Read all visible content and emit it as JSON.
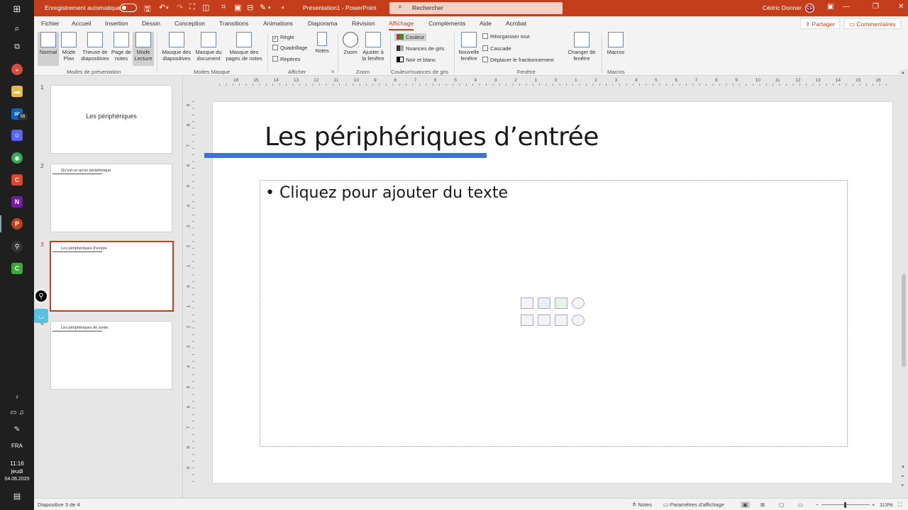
{
  "titlebar": {
    "autosave_label": "Enregistrement automatique",
    "doc_title": "Présentation1 - PowerPoint",
    "search_placeholder": "Rechercher",
    "user_name": "Cédric Donner",
    "user_initials": "CD"
  },
  "tabs": [
    "Fichier",
    "Accueil",
    "Insertion",
    "Dessin",
    "Conception",
    "Transitions",
    "Animations",
    "Diaporama",
    "Révision",
    "Affichage",
    "Compléments",
    "Aide",
    "Acrobat"
  ],
  "active_tab": "Affichage",
  "share_label": "Partager",
  "comments_label": "Commentaires",
  "ribbon": {
    "modes_presentation": {
      "group_label": "Modes de présentation",
      "buttons": [
        "Normal",
        "Mode Plan",
        "Trieuse de diapositives",
        "Page de notes",
        "Mode Lecture"
      ]
    },
    "modes_masque": {
      "group_label": "Modes Masque",
      "buttons": [
        "Masque des diapositives",
        "Masque du document",
        "Masque des pages de notes"
      ]
    },
    "afficher": {
      "group_label": "Afficher",
      "checks": [
        {
          "label": "Règle",
          "checked": true
        },
        {
          "label": "Quadrillage",
          "checked": false
        },
        {
          "label": "Repères",
          "checked": false
        }
      ],
      "notes_label": "Notes"
    },
    "zoom": {
      "group_label": "Zoom",
      "buttons": [
        "Zoom",
        "Ajuster à la fenêtre"
      ]
    },
    "couleur": {
      "group_label": "Couleur/nuances de gris",
      "options": [
        "Couleur",
        "Nuances de gris",
        "Noir et blanc"
      ]
    },
    "fenetre": {
      "group_label": "Fenêtre",
      "new_window": "Nouvelle fenêtre",
      "options": [
        "Réorganiser tout",
        "Cascade",
        "Déplacer le fractionnement"
      ],
      "switch": "Changer de fenêtre"
    },
    "macros": {
      "group_label": "Macros",
      "button": "Macros"
    }
  },
  "thumbnails": [
    {
      "num": "1",
      "text": "Les périphériques",
      "layout": "title"
    },
    {
      "num": "2",
      "text": "Qu'est-ce qu'un périphérique",
      "layout": "content"
    },
    {
      "num": "3",
      "text": "Les périphériques d'entrée",
      "layout": "content"
    },
    {
      "num": "4",
      "text": "Les périphériques de sortie",
      "layout": "content"
    }
  ],
  "slide": {
    "title": "Les périphériques d’entrée",
    "body_placeholder": "Cliquez pour ajouter du texte",
    "accent_color": "#4472C4"
  },
  "hruler_labels": [
    "16",
    "15",
    "14",
    "13",
    "12",
    "11",
    "10",
    "9",
    "8",
    "7",
    "6",
    "5",
    "4",
    "3",
    "2",
    "1",
    "0",
    "1",
    "2",
    "3",
    "4",
    "5",
    "6",
    "7",
    "8",
    "9",
    "10",
    "11",
    "12",
    "13",
    "14",
    "15",
    "16"
  ],
  "vruler_labels": [
    "9",
    "8",
    "7",
    "6",
    "5",
    "4",
    "3",
    "2",
    "1",
    "0",
    "1",
    "2",
    "3",
    "4",
    "5",
    "6",
    "7",
    "8",
    "9"
  ],
  "statusbar": {
    "slide_info": "Diapositive 3 de 4",
    "notes": "Notes",
    "display_settings": "Paramètres d'affichage",
    "zoom_level": "113%"
  },
  "taskbar": {
    "language": "FRA",
    "time": "11:16",
    "day": "jeudi",
    "date": "04.06.2020",
    "mail_badge": "58"
  },
  "colors": {
    "accent": "#C43E1C",
    "slide_bar": "#4472C4"
  }
}
